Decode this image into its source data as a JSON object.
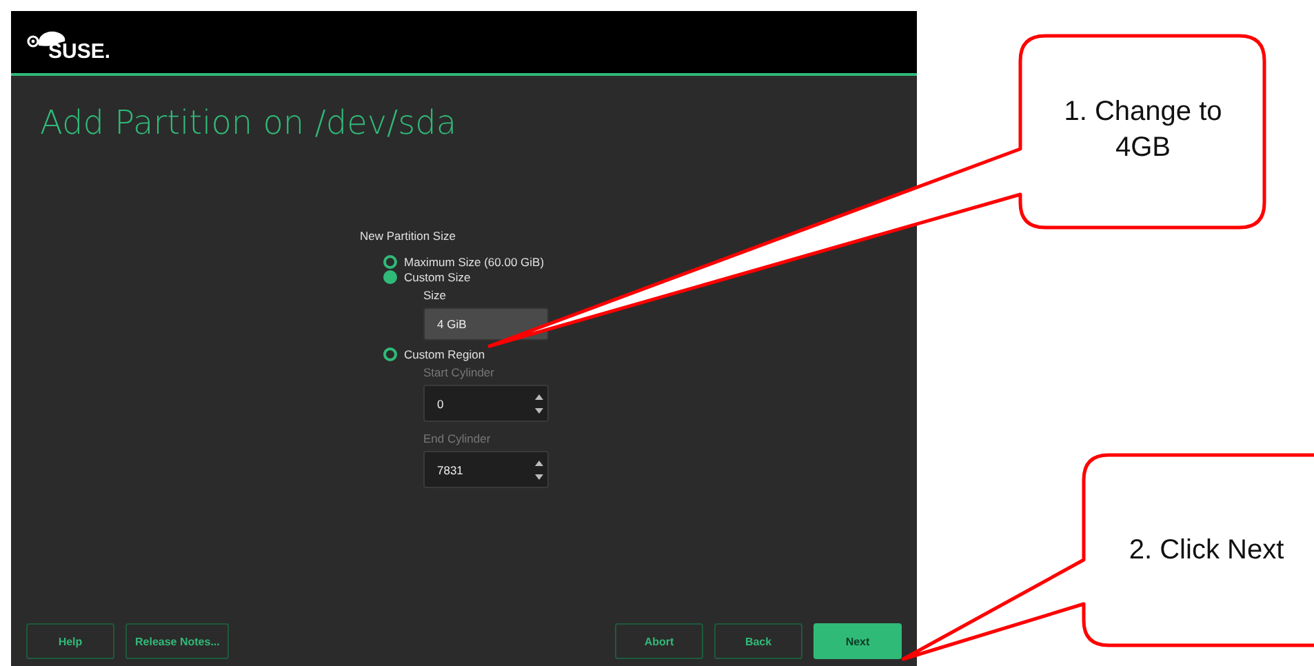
{
  "header": {
    "logo": "SUSE."
  },
  "title": "Add Partition on /dev/sda",
  "group": {
    "label": "New Partition Size",
    "options": [
      {
        "label": "Maximum Size (60.00 GiB)",
        "selected": false
      },
      {
        "label": "Custom Size",
        "selected": true,
        "fields": [
          {
            "label": "Size",
            "value": "4 GiB",
            "kind": "text",
            "disabled": false
          }
        ]
      },
      {
        "label": "Custom Region",
        "selected": false,
        "fields": [
          {
            "label": "Start Cylinder",
            "value": "0",
            "kind": "spin",
            "disabled": true
          },
          {
            "label": "End Cylinder",
            "value": "7831",
            "kind": "spin",
            "disabled": true
          }
        ]
      }
    ]
  },
  "buttons_left": [
    {
      "label": "Help",
      "primary": false
    },
    {
      "label": "Release Notes...",
      "primary": false
    }
  ],
  "buttons_right": [
    {
      "label": "Abort",
      "primary": false
    },
    {
      "label": "Back",
      "primary": false
    },
    {
      "label": "Next",
      "primary": true
    }
  ],
  "callouts": [
    {
      "text": "1. Change to 4GB"
    },
    {
      "text": "2. Click Next"
    }
  ]
}
